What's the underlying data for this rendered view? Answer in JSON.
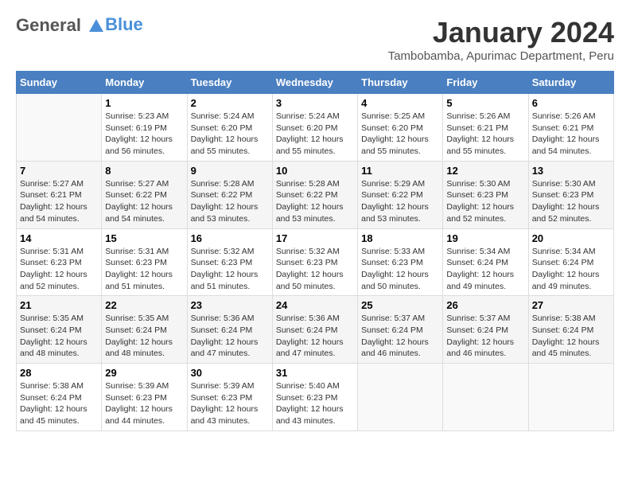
{
  "header": {
    "logo_line1": "General",
    "logo_line2": "Blue",
    "month_title": "January 2024",
    "location": "Tambobamba, Apurimac Department, Peru"
  },
  "days_of_week": [
    "Sunday",
    "Monday",
    "Tuesday",
    "Wednesday",
    "Thursday",
    "Friday",
    "Saturday"
  ],
  "weeks": [
    [
      {
        "day": "",
        "sunrise": "",
        "sunset": "",
        "daylight": ""
      },
      {
        "day": "1",
        "sunrise": "Sunrise: 5:23 AM",
        "sunset": "Sunset: 6:19 PM",
        "daylight": "Daylight: 12 hours and 56 minutes."
      },
      {
        "day": "2",
        "sunrise": "Sunrise: 5:24 AM",
        "sunset": "Sunset: 6:20 PM",
        "daylight": "Daylight: 12 hours and 55 minutes."
      },
      {
        "day": "3",
        "sunrise": "Sunrise: 5:24 AM",
        "sunset": "Sunset: 6:20 PM",
        "daylight": "Daylight: 12 hours and 55 minutes."
      },
      {
        "day": "4",
        "sunrise": "Sunrise: 5:25 AM",
        "sunset": "Sunset: 6:20 PM",
        "daylight": "Daylight: 12 hours and 55 minutes."
      },
      {
        "day": "5",
        "sunrise": "Sunrise: 5:26 AM",
        "sunset": "Sunset: 6:21 PM",
        "daylight": "Daylight: 12 hours and 55 minutes."
      },
      {
        "day": "6",
        "sunrise": "Sunrise: 5:26 AM",
        "sunset": "Sunset: 6:21 PM",
        "daylight": "Daylight: 12 hours and 54 minutes."
      }
    ],
    [
      {
        "day": "7",
        "sunrise": "Sunrise: 5:27 AM",
        "sunset": "Sunset: 6:21 PM",
        "daylight": "Daylight: 12 hours and 54 minutes."
      },
      {
        "day": "8",
        "sunrise": "Sunrise: 5:27 AM",
        "sunset": "Sunset: 6:22 PM",
        "daylight": "Daylight: 12 hours and 54 minutes."
      },
      {
        "day": "9",
        "sunrise": "Sunrise: 5:28 AM",
        "sunset": "Sunset: 6:22 PM",
        "daylight": "Daylight: 12 hours and 53 minutes."
      },
      {
        "day": "10",
        "sunrise": "Sunrise: 5:28 AM",
        "sunset": "Sunset: 6:22 PM",
        "daylight": "Daylight: 12 hours and 53 minutes."
      },
      {
        "day": "11",
        "sunrise": "Sunrise: 5:29 AM",
        "sunset": "Sunset: 6:22 PM",
        "daylight": "Daylight: 12 hours and 53 minutes."
      },
      {
        "day": "12",
        "sunrise": "Sunrise: 5:30 AM",
        "sunset": "Sunset: 6:23 PM",
        "daylight": "Daylight: 12 hours and 52 minutes."
      },
      {
        "day": "13",
        "sunrise": "Sunrise: 5:30 AM",
        "sunset": "Sunset: 6:23 PM",
        "daylight": "Daylight: 12 hours and 52 minutes."
      }
    ],
    [
      {
        "day": "14",
        "sunrise": "Sunrise: 5:31 AM",
        "sunset": "Sunset: 6:23 PM",
        "daylight": "Daylight: 12 hours and 52 minutes."
      },
      {
        "day": "15",
        "sunrise": "Sunrise: 5:31 AM",
        "sunset": "Sunset: 6:23 PM",
        "daylight": "Daylight: 12 hours and 51 minutes."
      },
      {
        "day": "16",
        "sunrise": "Sunrise: 5:32 AM",
        "sunset": "Sunset: 6:23 PM",
        "daylight": "Daylight: 12 hours and 51 minutes."
      },
      {
        "day": "17",
        "sunrise": "Sunrise: 5:32 AM",
        "sunset": "Sunset: 6:23 PM",
        "daylight": "Daylight: 12 hours and 50 minutes."
      },
      {
        "day": "18",
        "sunrise": "Sunrise: 5:33 AM",
        "sunset": "Sunset: 6:23 PM",
        "daylight": "Daylight: 12 hours and 50 minutes."
      },
      {
        "day": "19",
        "sunrise": "Sunrise: 5:34 AM",
        "sunset": "Sunset: 6:24 PM",
        "daylight": "Daylight: 12 hours and 49 minutes."
      },
      {
        "day": "20",
        "sunrise": "Sunrise: 5:34 AM",
        "sunset": "Sunset: 6:24 PM",
        "daylight": "Daylight: 12 hours and 49 minutes."
      }
    ],
    [
      {
        "day": "21",
        "sunrise": "Sunrise: 5:35 AM",
        "sunset": "Sunset: 6:24 PM",
        "daylight": "Daylight: 12 hours and 48 minutes."
      },
      {
        "day": "22",
        "sunrise": "Sunrise: 5:35 AM",
        "sunset": "Sunset: 6:24 PM",
        "daylight": "Daylight: 12 hours and 48 minutes."
      },
      {
        "day": "23",
        "sunrise": "Sunrise: 5:36 AM",
        "sunset": "Sunset: 6:24 PM",
        "daylight": "Daylight: 12 hours and 47 minutes."
      },
      {
        "day": "24",
        "sunrise": "Sunrise: 5:36 AM",
        "sunset": "Sunset: 6:24 PM",
        "daylight": "Daylight: 12 hours and 47 minutes."
      },
      {
        "day": "25",
        "sunrise": "Sunrise: 5:37 AM",
        "sunset": "Sunset: 6:24 PM",
        "daylight": "Daylight: 12 hours and 46 minutes."
      },
      {
        "day": "26",
        "sunrise": "Sunrise: 5:37 AM",
        "sunset": "Sunset: 6:24 PM",
        "daylight": "Daylight: 12 hours and 46 minutes."
      },
      {
        "day": "27",
        "sunrise": "Sunrise: 5:38 AM",
        "sunset": "Sunset: 6:24 PM",
        "daylight": "Daylight: 12 hours and 45 minutes."
      }
    ],
    [
      {
        "day": "28",
        "sunrise": "Sunrise: 5:38 AM",
        "sunset": "Sunset: 6:24 PM",
        "daylight": "Daylight: 12 hours and 45 minutes."
      },
      {
        "day": "29",
        "sunrise": "Sunrise: 5:39 AM",
        "sunset": "Sunset: 6:23 PM",
        "daylight": "Daylight: 12 hours and 44 minutes."
      },
      {
        "day": "30",
        "sunrise": "Sunrise: 5:39 AM",
        "sunset": "Sunset: 6:23 PM",
        "daylight": "Daylight: 12 hours and 43 minutes."
      },
      {
        "day": "31",
        "sunrise": "Sunrise: 5:40 AM",
        "sunset": "Sunset: 6:23 PM",
        "daylight": "Daylight: 12 hours and 43 minutes."
      },
      {
        "day": "",
        "sunrise": "",
        "sunset": "",
        "daylight": ""
      },
      {
        "day": "",
        "sunrise": "",
        "sunset": "",
        "daylight": ""
      },
      {
        "day": "",
        "sunrise": "",
        "sunset": "",
        "daylight": ""
      }
    ]
  ]
}
